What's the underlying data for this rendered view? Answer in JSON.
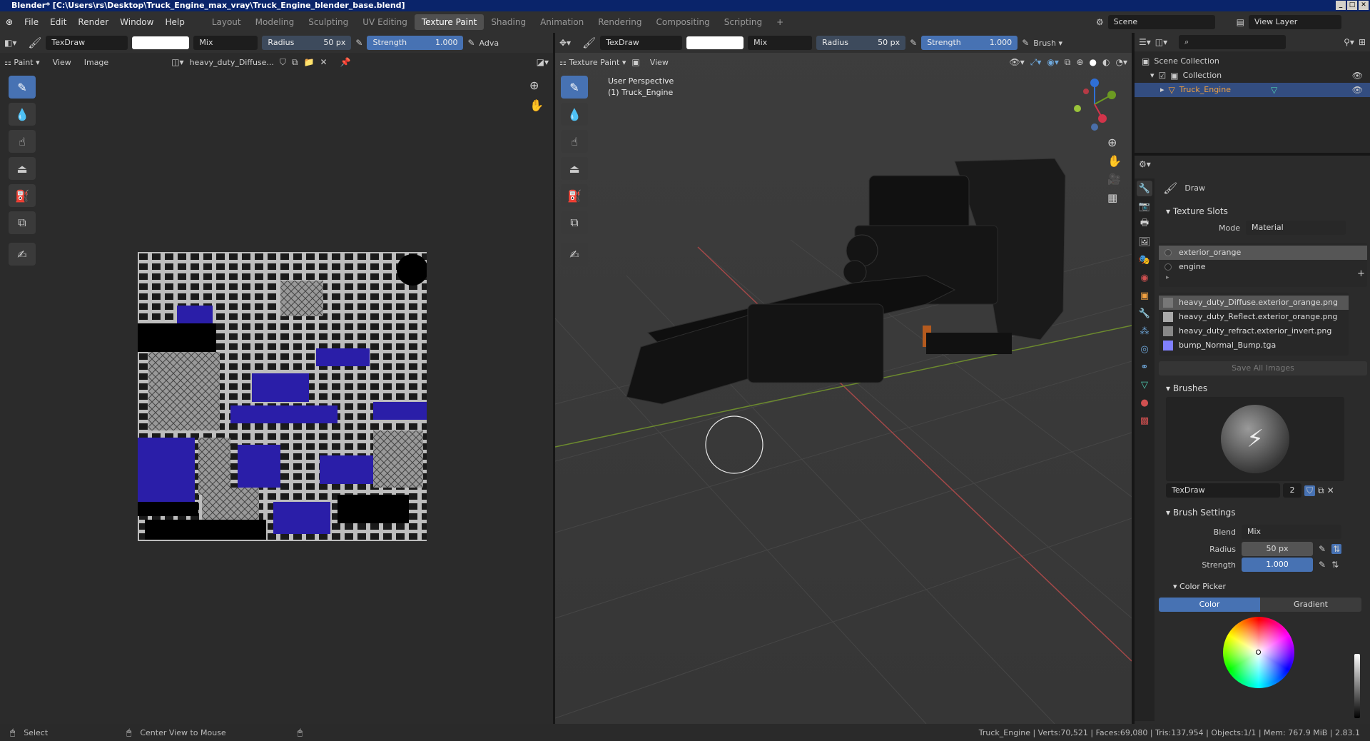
{
  "title": "Blender* [C:\\Users\\rs\\Desktop\\Truck_Engine_max_vray\\Truck_Engine_blender_base.blend]",
  "menus": [
    "File",
    "Edit",
    "Render",
    "Window",
    "Help"
  ],
  "workspaces": [
    "Layout",
    "Modeling",
    "Sculpting",
    "UV Editing",
    "Texture Paint",
    "Shading",
    "Animation",
    "Rendering",
    "Compositing",
    "Scripting"
  ],
  "scene": "Scene",
  "view_layer": "View Layer",
  "left": {
    "brush": "TexDraw",
    "blend": "Mix",
    "radius_label": "Radius",
    "radius": "50 px",
    "strength_label": "Strength",
    "strength": "1.000",
    "adv": "Adva",
    "mode": "Paint",
    "view": "View",
    "image": "Image",
    "image_name": "heavy_duty_Diffuse..."
  },
  "right": {
    "brush": "TexDraw",
    "blend": "Mix",
    "radius_label": "Radius",
    "radius": "50 px",
    "strength_label": "Strength",
    "strength": "1.000",
    "brush_menu": "Brush",
    "mode": "Texture Paint",
    "view": "View",
    "perspective": "User Perspective",
    "object": "(1) Truck_Engine"
  },
  "outliner": {
    "scene_collection": "Scene Collection",
    "collection": "Collection",
    "object": "Truck_Engine"
  },
  "props": {
    "tool": "Draw",
    "texture_slots": "Texture Slots",
    "mode_label": "Mode",
    "mode": "Material",
    "materials": [
      "exterior_orange",
      "engine"
    ],
    "images": [
      "heavy_duty_Diffuse.exterior_orange.png",
      "heavy_duty_Reflect.exterior_orange.png",
      "heavy_duty_refract.exterior_invert.png",
      "bump_Normal_Bump.tga"
    ],
    "save_all": "Save All Images",
    "brushes": "Brushes",
    "brush_name": "TexDraw",
    "brush_users": "2",
    "brush_settings": "Brush Settings",
    "blend_label": "Blend",
    "blend": "Mix",
    "radius_label": "Radius",
    "radius": "50 px",
    "strength_label": "Strength",
    "strength": "1.000",
    "color_picker": "Color Picker",
    "color_tab": "Color",
    "gradient_tab": "Gradient"
  },
  "status": {
    "select": "Select",
    "center": "Center View to Mouse",
    "stats": "Truck_Engine | Verts:70,521 | Faces:69,080 | Tris:137,954 | Objects:1/1 | Mem: 767.9 MiB | 2.83.1"
  }
}
